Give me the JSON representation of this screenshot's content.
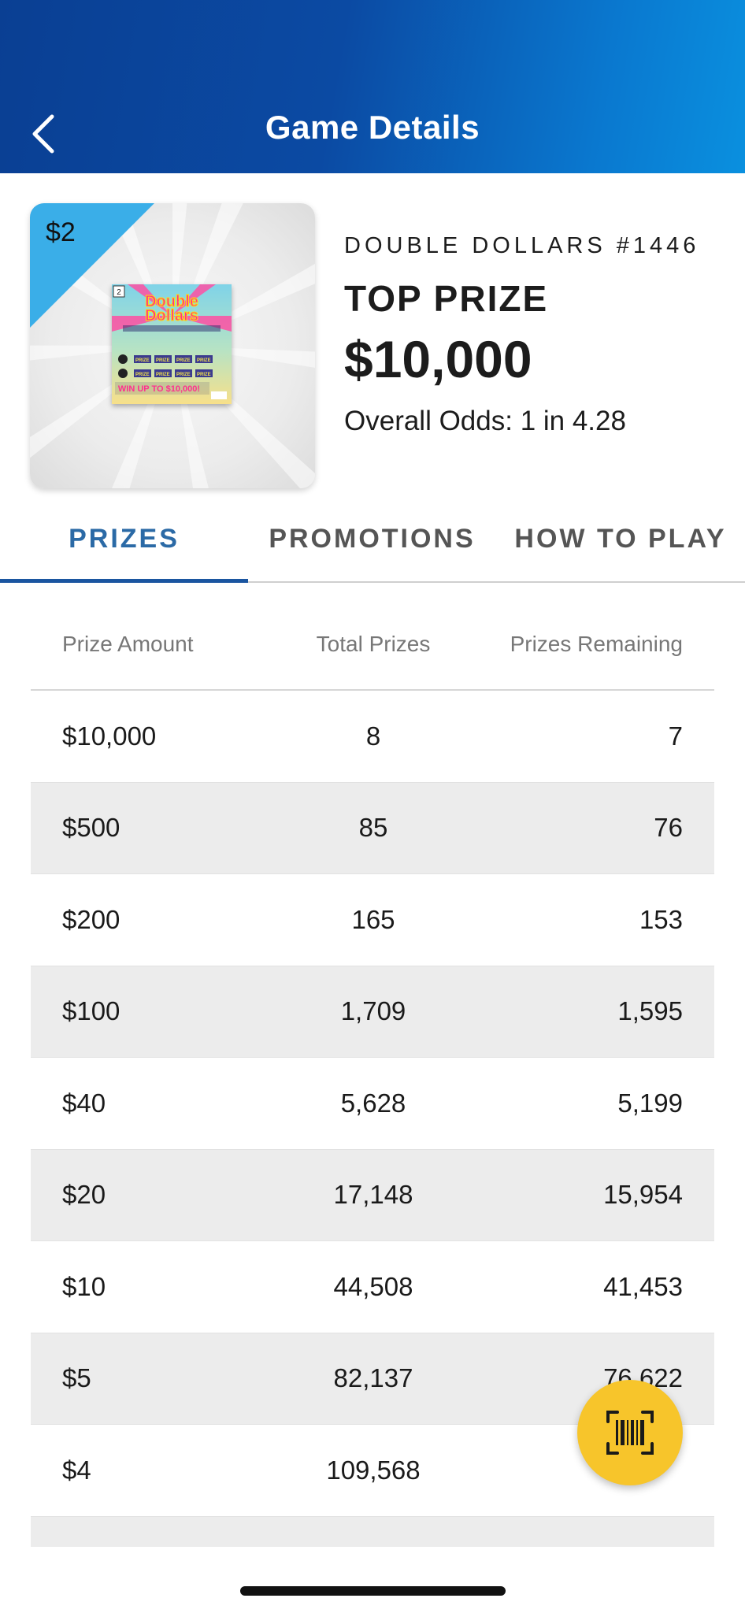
{
  "header": {
    "title": "Game Details",
    "back_icon": "chevron-left-icon"
  },
  "game": {
    "price": "$2",
    "name": "DOUBLE DOLLARS #1446",
    "top_prize_label": "TOP PRIZE",
    "top_prize_value": "$10,000",
    "odds": "Overall Odds: 1 in 4.28",
    "ticket_title_line1": "Double",
    "ticket_title_line2": "Dollars",
    "ticket_banner": "WIN UP TO $10,000!",
    "ticket_prize_text": "PRIZE"
  },
  "tabs": [
    {
      "label": "PRIZES",
      "active": true
    },
    {
      "label": "PROMOTIONS",
      "active": false
    },
    {
      "label": "HOW TO PLAY",
      "active": false
    }
  ],
  "table": {
    "headers": [
      "Prize Amount",
      "Total Prizes",
      "Prizes Remaining"
    ],
    "rows": [
      [
        "$10,000",
        "8",
        "7"
      ],
      [
        "$500",
        "85",
        "76"
      ],
      [
        "$200",
        "165",
        "153"
      ],
      [
        "$100",
        "1,709",
        "1,595"
      ],
      [
        "$40",
        "5,628",
        "5,199"
      ],
      [
        "$20",
        "17,148",
        "15,954"
      ],
      [
        "$10",
        "44,508",
        "41,453"
      ],
      [
        "$5",
        "82,137",
        "76,622"
      ],
      [
        "$4",
        "109,568",
        ""
      ]
    ]
  },
  "fab": {
    "icon": "barcode-scan-icon"
  },
  "colors": {
    "brand": "#0b4aa3",
    "accent": "#f7c52b",
    "price_corner": "#3aaee8",
    "active_tab": "#2b6aa6"
  }
}
